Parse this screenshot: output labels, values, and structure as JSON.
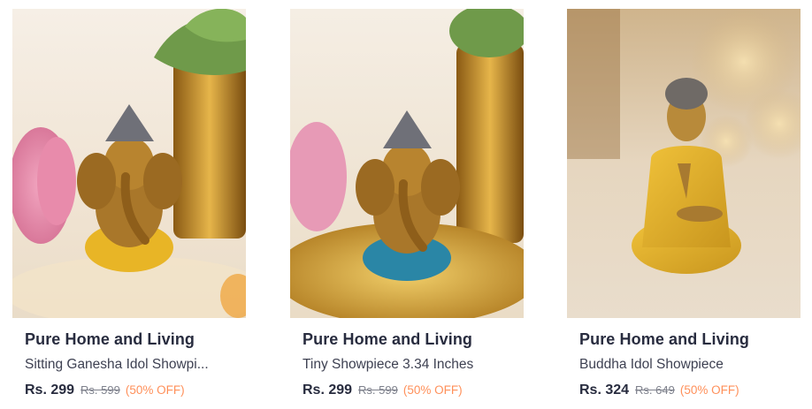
{
  "colors": {
    "brand_text": "#282c3f",
    "name_text": "#3e4152",
    "mrp_text": "#7e818c",
    "discount_text": "#ff905a"
  },
  "products": [
    {
      "brand": "Pure Home and Living",
      "name": "Sitting Ganesha Idol Showpi...",
      "price": "Rs. 299",
      "mrp": "Rs. 599",
      "discount": "(50% OFF)"
    },
    {
      "brand": "Pure Home and Living",
      "name": "Tiny Showpiece 3.34 Inches",
      "price": "Rs. 299",
      "mrp": "Rs. 599",
      "discount": "(50% OFF)"
    },
    {
      "brand": "Pure Home and Living",
      "name": "Buddha Idol Showpiece",
      "price": "Rs. 324",
      "mrp": "Rs. 649",
      "discount": "(50% OFF)"
    }
  ]
}
